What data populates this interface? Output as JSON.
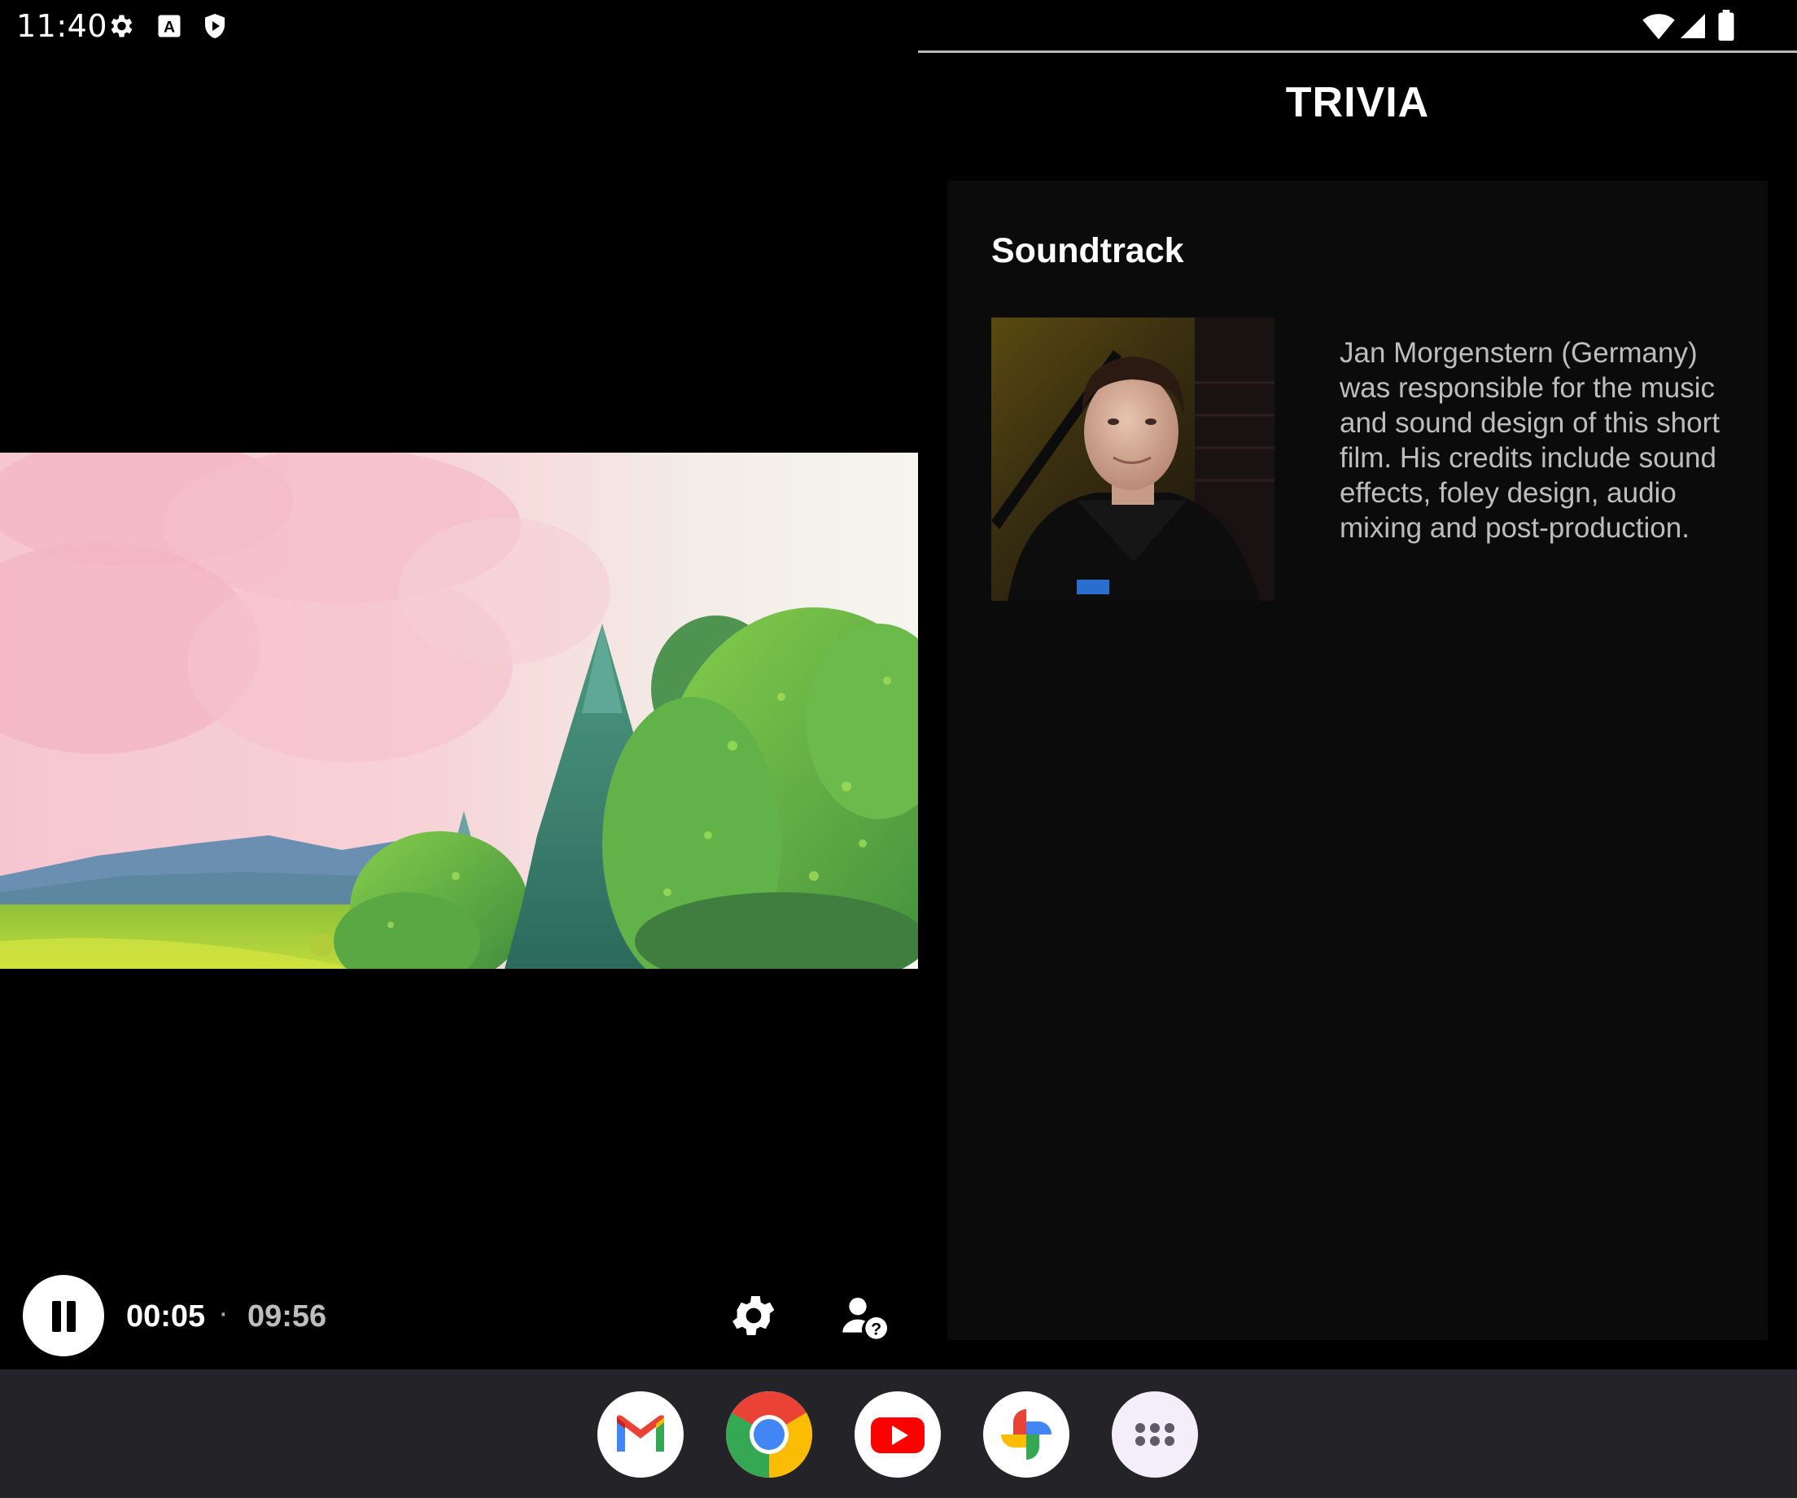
{
  "status_bar": {
    "time": "11:40",
    "left_icons": [
      "settings-gear-icon",
      "font-a-icon",
      "shield-play-icon"
    ],
    "right_icons": [
      "wifi-icon",
      "cell-signal-icon",
      "battery-icon"
    ]
  },
  "player": {
    "state": "playing",
    "current_time": "00:05",
    "separator": "·",
    "duration": "09:56",
    "progress_fraction": 0.0084,
    "controls": [
      "pause-icon",
      "gear-icon",
      "person-help-icon"
    ]
  },
  "trivia": {
    "title": "TRIVIA",
    "card": {
      "heading": "Soundtrack",
      "photo_icon": "composer-portrait",
      "body": "Jan Morgenstern (Germany) was responsible for the music and sound design of this short film. His credits include sound effects, foley design, audio mixing and post-production."
    }
  },
  "dock": {
    "apps": [
      "gmail-icon",
      "chrome-icon",
      "youtube-icon",
      "photos-icon",
      "app-drawer-icon"
    ]
  },
  "colors": {
    "background": "#000000",
    "card_background": "#0b0b0b",
    "taskbar": "#242428",
    "text_primary": "#ffffff",
    "text_secondary": "#bdbdbd"
  }
}
